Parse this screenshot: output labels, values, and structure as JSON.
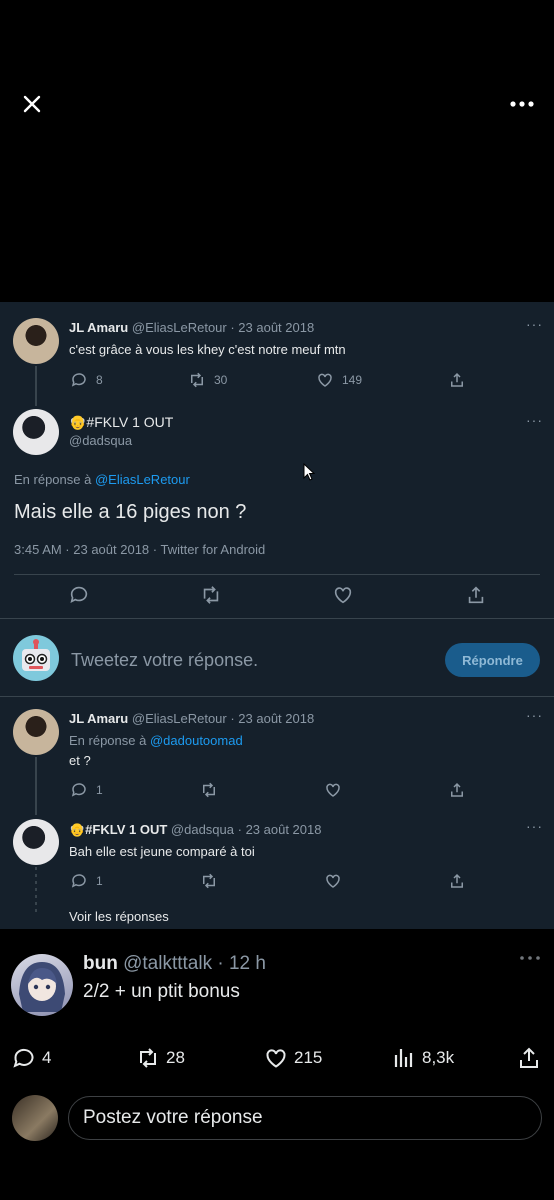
{
  "top": {
    "close_icon": "close-icon",
    "more_icon": "more-horizontal-icon"
  },
  "screenshot": {
    "tweet1": {
      "name": "JL Amaru",
      "handle": "@EliasLeRetour",
      "date": "· 23 août 2018",
      "text": "c'est grâce à vous les khey c'est notre meuf mtn",
      "replies": "8",
      "retweets": "30",
      "likes": "149"
    },
    "main": {
      "name": "👴#FKLV 1 OUT",
      "handle": "@dadsqua",
      "reply_prefix": "En réponse à",
      "reply_to": "@EliasLeRetour",
      "text": "Mais elle a 16 piges non ?",
      "meta": "3:45 AM · 23 août 2018 · Twitter for Android"
    },
    "compose": {
      "placeholder": "Tweetez votre réponse.",
      "button": "Répondre"
    },
    "tweet3": {
      "name": "JL Amaru",
      "handle": "@EliasLeRetour",
      "date": "· 23 août 2018",
      "reply_prefix": "En réponse à",
      "reply_to": "@dadoutoomad",
      "text": "et ?",
      "replies": "1"
    },
    "tweet4": {
      "name": "👴#FKLV 1 OUT",
      "handle": "@dadsqua",
      "date": "· 23 août 2018",
      "text": "Bah elle est jeune comparé à toi",
      "replies": "1"
    },
    "see_replies": "Voir les réponses"
  },
  "post": {
    "name": "bun",
    "handle": "@talktttalk",
    "time": "· 12 h",
    "text": "2/2 + un ptit bonus",
    "replies": "4",
    "reposts": "28",
    "likes": "215",
    "views": "8,3k"
  },
  "reply_bar": {
    "placeholder": "Postez votre réponse"
  },
  "colors": {
    "accent": "#1d9bf0",
    "dim_bg": "#15202b",
    "muted": "#8b98a5"
  }
}
